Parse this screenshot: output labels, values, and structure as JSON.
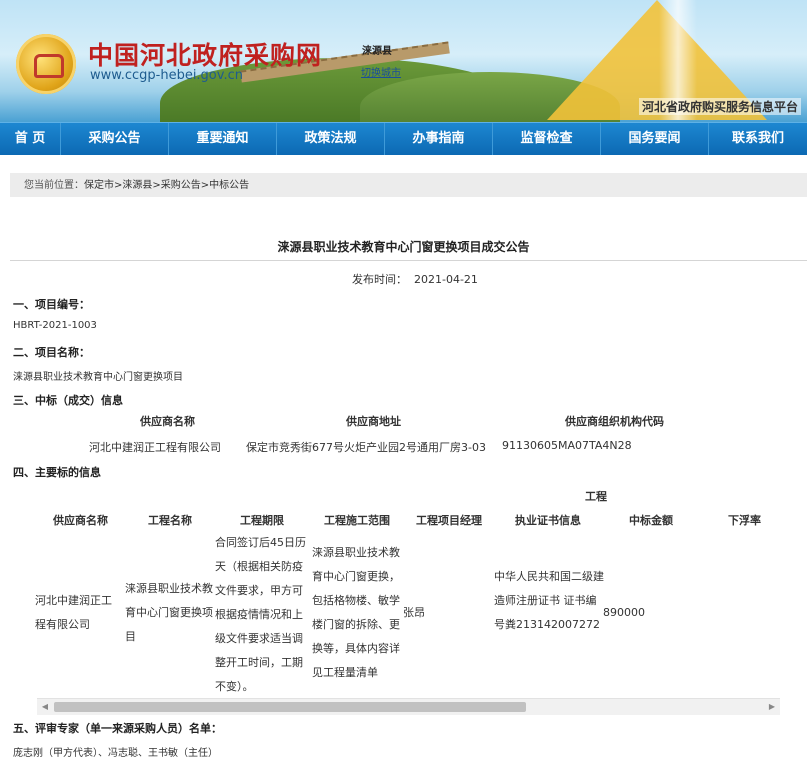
{
  "header": {
    "site_title": "中国河北政府采购网",
    "site_url": "www.ccgp-hebei.gov.cn",
    "county": "涞源县",
    "switch_city": "切换城市",
    "platform": "河北省政府购买服务信息平台"
  },
  "nav": [
    "首 页",
    "采购公告",
    "重要通知",
    "政策法规",
    "办事指南",
    "监督检查",
    "国务要闻",
    "联系我们"
  ],
  "breadcrumb": {
    "label": "您当前位置：",
    "path": "保定市>涞源县>采购公告>中标公告"
  },
  "article": {
    "title": "涞源县职业技术教育中心门窗更换项目成交公告",
    "pub_label": "发布时间：",
    "pub_time": "2021-04-21",
    "s1_title": "一、项目编号：",
    "s1_value": "HBRT-2021-1003",
    "s2_title": "二、项目名称：",
    "s2_value": "涞源县职业技术教育中心门窗更换项目",
    "s3_title": "三、中标（成交）信息",
    "supplier_headers": [
      "供应商名称",
      "供应商地址",
      "供应商组织机构代码"
    ],
    "supplier_row": [
      "河北中建润正工程有限公司",
      "保定市竞秀街677号火炬产业园2号通用厂房3-03",
      "91130605MA07TA4N28"
    ],
    "s4_title": "四、主要标的信息",
    "group_header": "工程",
    "main_headers": [
      "供应商名称",
      "工程名称",
      "工程期限",
      "工程施工范围",
      "工程项目经理",
      "执业证书信息",
      "中标金额",
      "下浮率"
    ],
    "main_row": {
      "supplier": "河北中建润正工程有限公司",
      "project": "涞源县职业技术教育中心门窗更换项目",
      "period": "合同签订后45日历天（根据相关防疫文件要求，甲方可根据疫情情况和上级文件要求适当调整开工时间，工期不变）。",
      "scope": "涞源县职业技术教育中心门窗更换，包括格物楼、敏学楼门窗的拆除、更换等，具体内容详见工程量清单",
      "manager": "张昂",
      "cert": "中华人民共和国二级建造师注册证书 证书编号粪213142007272",
      "amount": "890000"
    },
    "s5_title": "五、评审专家（单一来源采购人员）名单：",
    "s5_value": "庞志刚（甲方代表）、冯志聪、王书敏（主任）"
  }
}
